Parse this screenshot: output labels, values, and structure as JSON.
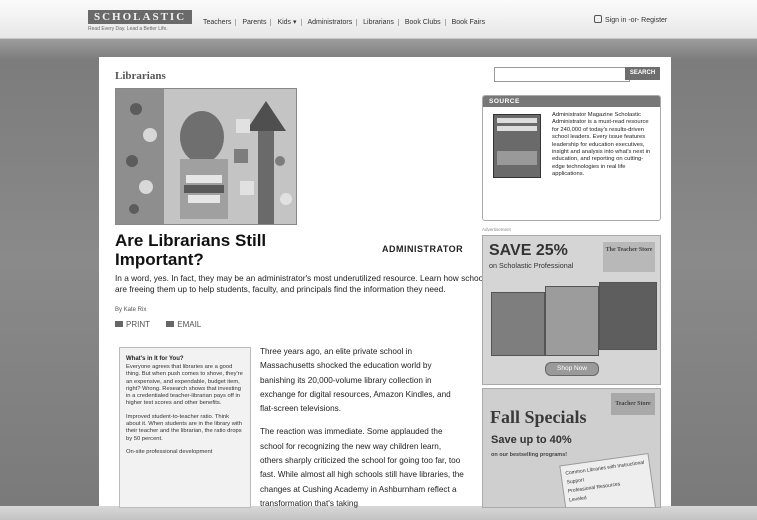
{
  "header": {
    "logo": "SCHOLASTIC",
    "tagline": "Read Every Day. Lead a Better Life.",
    "nav": [
      "Teachers",
      "Parents",
      "Kids ▾",
      "Administrators",
      "Librarians",
      "Book Clubs",
      "Book Fairs"
    ],
    "signin": "Sign in -or- Register"
  },
  "page": {
    "section": "Librarians",
    "headline": "Are Librarians Still Important?",
    "publication": "ADMINISTRATOR",
    "deck": "In a word, yes. In fact, they may be an administrator's most underutilized resource. Learn how schools are freeing them up to help students, faculty, and principals find the information they need.",
    "byline": "By Kate Rix",
    "print": "PRINT",
    "email": "EMAIL"
  },
  "sidebar_box": {
    "title": "What's in It for You?",
    "p1": "Everyone agrees that libraries are a good thing. But when push comes to shove, they're an expensive, and expendable, budget item, right? Wrong. Research shows that investing in a credentialed teacher-librarian pays off in higher test scores and other benefits.",
    "p2": "Improved student-to-teacher ratio. Think about it. When students are in the library with their teacher and the librarian, the ratio drops by 50 percent.",
    "p3": "On-site professional development"
  },
  "body": {
    "p1": "Three years ago, an elite private school in Massachusetts shocked the education world by banishing its 20,000-volume library collection in exchange for digital resources, Amazon Kindles, and flat-screen televisions.",
    "p2": "The reaction was immediate. Some applauded the school for recognizing the new way children learn, others sharply criticized the school for going too far, too fast. While almost all high schools still have libraries, the changes at Cushing Academy in Ashburnham reflect a transformation that's taking"
  },
  "right": {
    "search_button": "SEARCH",
    "source_header": "SOURCE",
    "source_text": "Administrator Magazine Scholastic Administrator is a must-read resource for 240,000 of today's results-driven school leaders. Every issue features leadership for education executives, insight and analysis into what's next in education, and reporting on cutting-edge technologies in real life applications.",
    "ad_label": "Advertisement",
    "ad1_headline": "SAVE 25%",
    "ad1_sub": "on Scholastic Professional",
    "ad1_badge": "The Teacher Store",
    "ad1_button": "Shop Now",
    "ad2_title": "Fall Specials",
    "ad2_save": "Save up to 40%",
    "ad2_small": "on our bestselling programs!",
    "ad2_store": "Teacher Store",
    "ad2_list": [
      "Common Libraries with Instructional Support",
      "Professional Resources",
      "Leveled"
    ]
  }
}
